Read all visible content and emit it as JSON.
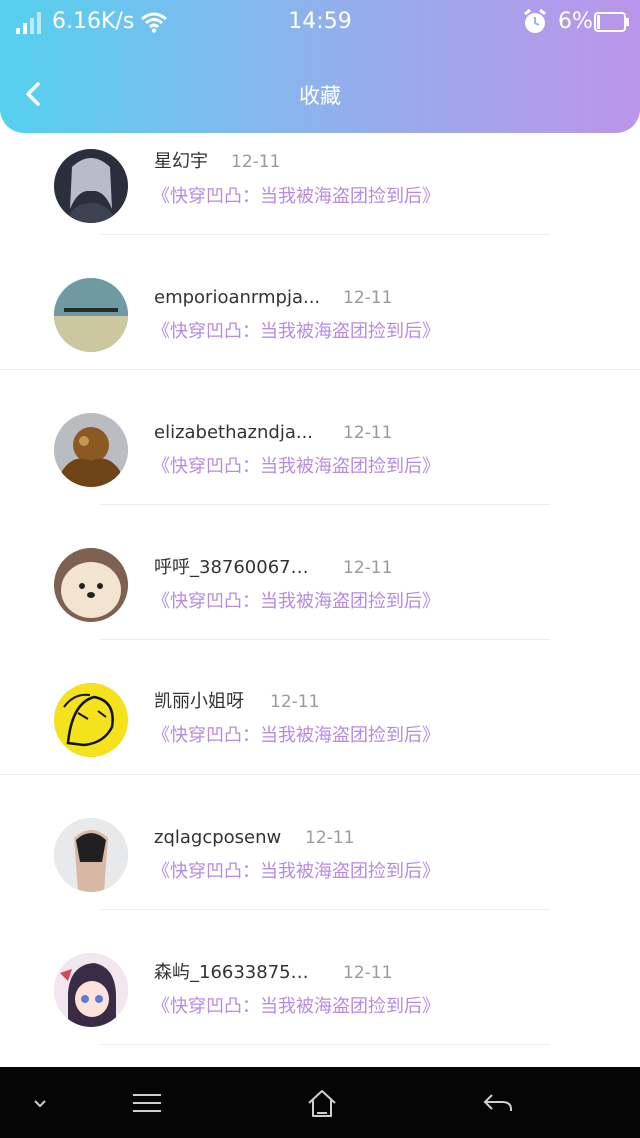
{
  "status_bar": {
    "network_speed": "6.16K/s",
    "time": "14:59",
    "battery_percent": "6%",
    "icons": [
      "signal-icon",
      "wifi-icon",
      "alarm-icon",
      "battery-icon"
    ]
  },
  "nav": {
    "title": "收藏",
    "back_icon": "chevron-left-icon"
  },
  "colors": {
    "header_gradient_start": "#55d1ef",
    "header_gradient_end": "#bb95ea",
    "book_title": "#b68be0",
    "date": "#9a9a9a",
    "name": "#333333",
    "system_bar": "#050505"
  },
  "items": [
    {
      "name": "星幻宇",
      "date": "12-11",
      "book": "《快穿凹凸：当我被海盗团捡到后》"
    },
    {
      "name": "emporioanrmpja...",
      "date": "12-11",
      "book": "《快穿凹凸：当我被海盗团捡到后》"
    },
    {
      "name": "elizabethazndja...",
      "date": "12-11",
      "book": "《快穿凹凸：当我被海盗团捡到后》"
    },
    {
      "name": "呼呼_38760067…",
      "date": "12-11",
      "book": "《快穿凹凸：当我被海盗团捡到后》"
    },
    {
      "name": "凯丽小姐呀",
      "date": "12-11",
      "book": "《快穿凹凸：当我被海盗团捡到后》"
    },
    {
      "name": "zqlagcposenw",
      "date": "12-11",
      "book": "《快穿凹凸：当我被海盗团捡到后》"
    },
    {
      "name": "森屿_16633875…",
      "date": "12-11",
      "book": "《快穿凹凸：当我被海盗团捡到后》"
    }
  ],
  "system_nav": {
    "icons": [
      "collapse-icon",
      "menu-icon",
      "home-icon",
      "back-icon"
    ]
  }
}
